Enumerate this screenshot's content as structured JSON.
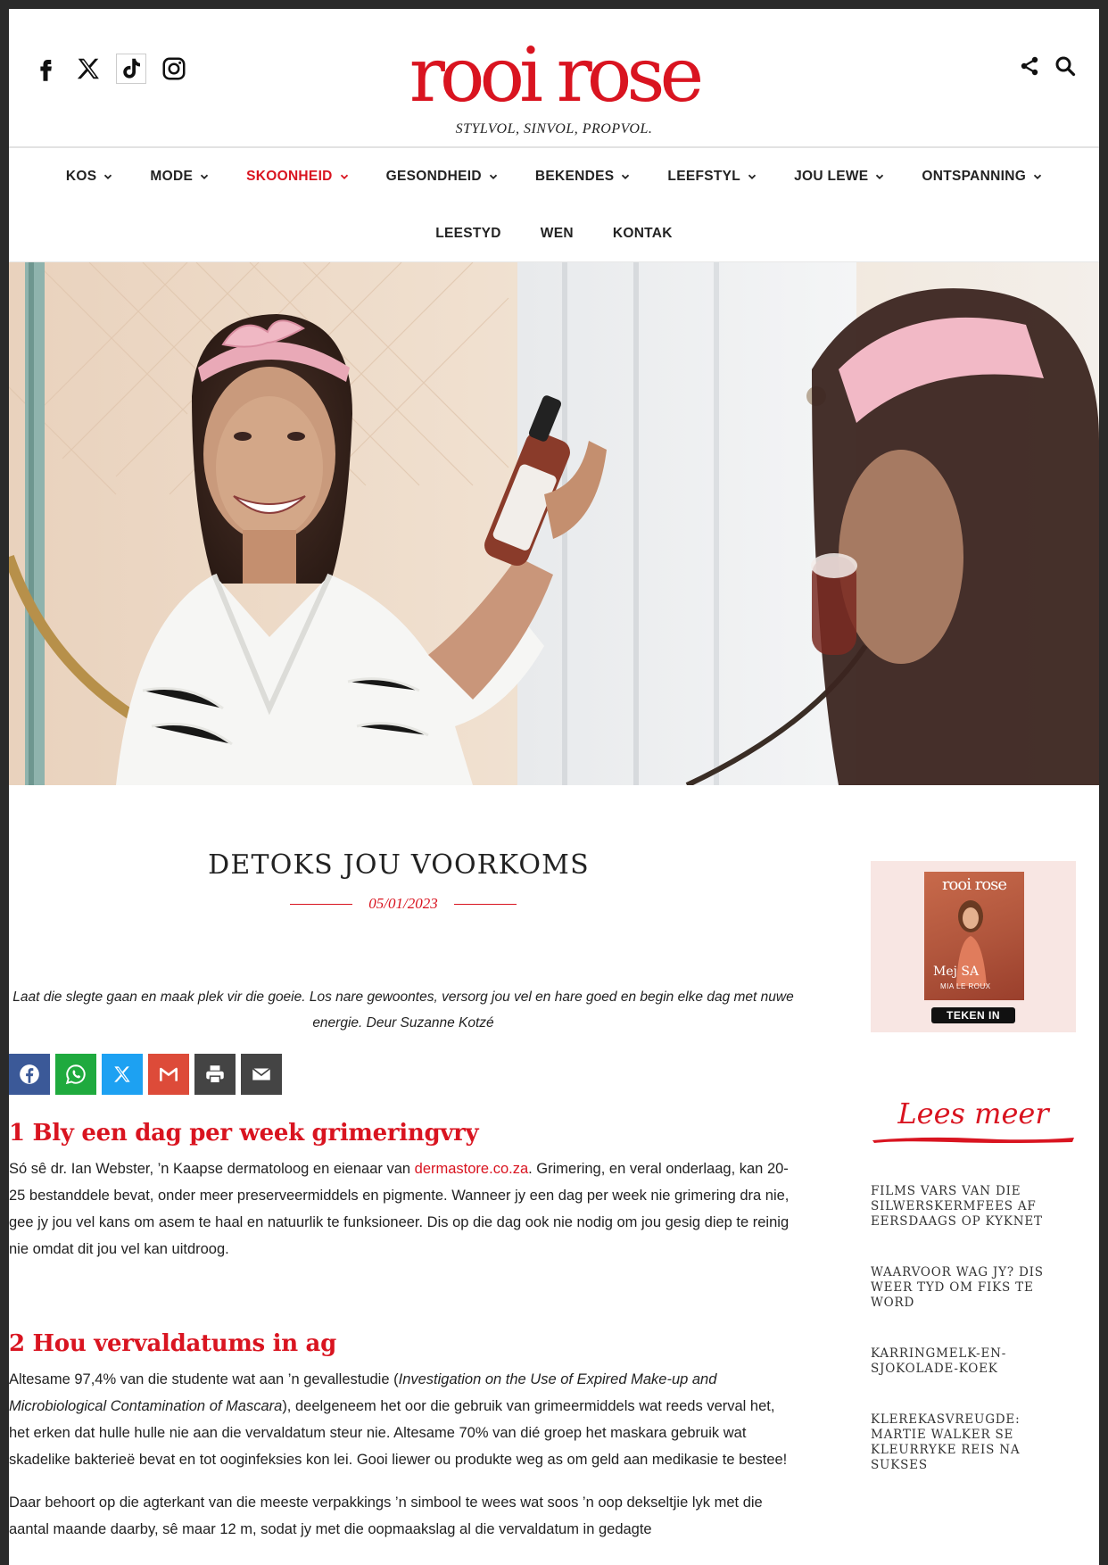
{
  "header": {
    "logo_text": "rooi rose",
    "tagline": "STYLVOL, SINVOL, PROPVOL.",
    "social_icons": [
      "facebook-icon",
      "x-icon",
      "tiktok-icon",
      "instagram-icon"
    ],
    "tool_icons": [
      "share-icon",
      "search-icon"
    ]
  },
  "nav": {
    "row1": [
      {
        "label": "KOS",
        "active": false
      },
      {
        "label": "MODE",
        "active": false
      },
      {
        "label": "SKOONHEID",
        "active": true
      },
      {
        "label": "GESONDHEID",
        "active": false
      },
      {
        "label": "BEKENDES",
        "active": false
      },
      {
        "label": "LEEFSTYL",
        "active": false
      },
      {
        "label": "JOU LEWE",
        "active": false
      },
      {
        "label": "ONTSPANNING",
        "active": false
      }
    ],
    "row2": [
      "LEESTYD",
      "WEN",
      "KONTAK"
    ]
  },
  "article": {
    "title": "DETOKS JOU VOORKOMS",
    "date": "05/01/2023",
    "intro": "Laat die slegte gaan en maak plek vir die goeie. Los nare gewoontes, versorg jou vel en hare goed en begin elke dag met nuwe energie. Deur Suzanne Kotzé",
    "share_buttons": [
      "facebook-icon",
      "whatsapp-icon",
      "x-icon",
      "gmail-icon",
      "print-icon",
      "email-icon"
    ],
    "section1": {
      "heading": "1 Bly een dag per week grimeringvry",
      "p_before_link": "Só sê dr. Ian Webster, ’n Kaapse dermatoloog en eienaar van ",
      "link": "dermastore.co.za",
      "p_after_link": ". Grimering, en veral onderlaag, kan 20-25 bestanddele bevat, onder meer preserveermiddels en pigmente. Wanneer jy een dag per week nie grimering dra nie, gee jy jou vel kans om asem te haal en natuurlik te funksioneer. Dis op die dag ook nie nodig om jou gesig diep te reinig nie omdat dit jou vel kan uitdroog."
    },
    "section2": {
      "heading": "2 Hou vervaldatums in ag",
      "p1_before": "Altesame 97,4% van die studente wat aan ’n gevallestudie (",
      "p1_italic": "Investigation on the Use of Expired Make-up and Microbiological Contamination of Mascara",
      "p1_after": "), deelgeneem het oor die gebruik van grimeermiddels wat reeds verval het, het erken dat hulle hulle nie aan die vervaldatum steur nie. Altesame 70% van dié groep het maskara gebruik wat skadelike bakterieë bevat en tot ooginfeksies kon lei. Gooi liewer ou produkte weg as om geld aan medikasie te bestee!",
      "p2": "Daar behoort op die agterkant van die meeste verpakkings ’n simbool te wees wat soos ’n oop dekseltjie lyk met die aantal maande daarby, sê maar 12 m, sodat jy met die oopmaakslag al die vervaldatum in gedagte"
    }
  },
  "sidebar": {
    "magazine": {
      "cover_logo": "rooi rose",
      "cover_name": "Mej SA",
      "cover_subname": "MIA LE ROUX",
      "signup_label": "TEKEN IN"
    },
    "lees_meer": "Lees meer",
    "links": [
      "FILMS VARS VAN DIE SILWERSKERMFEES AF EERSDAAGS OP KYKNET",
      "WAARVOOR WAG JY? DIS WEER TYD OM FIKS TE WORD",
      "KARRINGMELK-EN-SJOKOLADE-KOEK",
      "KLEREKASVREUGDE: MARTIE WALKER SE KLEURRYKE REIS NA SUKSES"
    ]
  },
  "colors": {
    "accent": "#d91420",
    "page_background": "#2a2a2a"
  }
}
